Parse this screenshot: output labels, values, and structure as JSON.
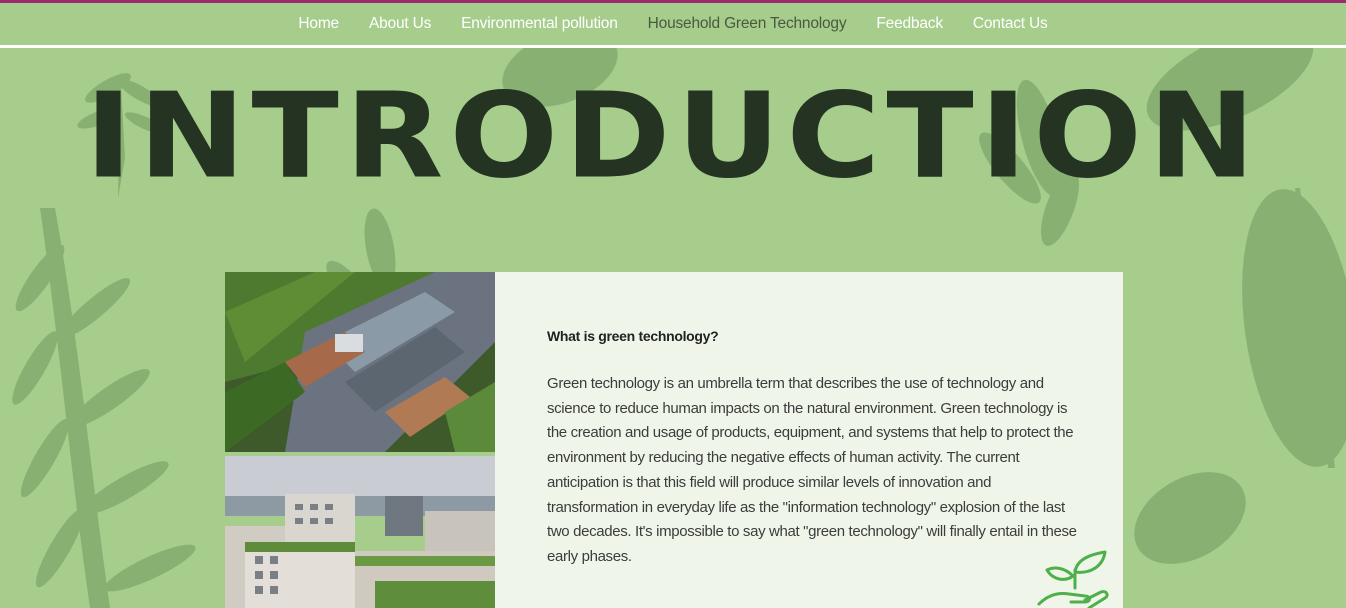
{
  "colors": {
    "background": "#a6cd8c",
    "accent_bar": "#9b2b6e",
    "title": "#243322",
    "card_bg": "#f4f9f0",
    "icon": "#4db04a"
  },
  "nav": {
    "items": [
      {
        "label": "Home"
      },
      {
        "label": "About Us"
      },
      {
        "label": "Environmental pollution"
      },
      {
        "label": "Household Green Technology",
        "active": true
      },
      {
        "label": "Feedback"
      },
      {
        "label": "Contact Us"
      }
    ]
  },
  "page": {
    "title": "INTRODUCTION"
  },
  "images": {
    "top": {
      "icon": "rooftop-garden-photo"
    },
    "bottom": {
      "icon": "green-roof-buildings-photo"
    }
  },
  "card": {
    "heading": "What is green technology?",
    "body": "Green technology is an umbrella term that describes the use of technology and science to reduce human impacts on the natural environment. Green technology is the creation and usage of products, equipment, and systems that help to protect the environment by reducing the negative effects of human activity. The current anticipation is that this field will produce similar levels of innovation and transformation in everyday life as the \"information technology\" explosion of the last two decades. It's impossible to say what \"green technology\" will finally entail in these early phases.",
    "icon": "plant-in-hand-icon"
  }
}
